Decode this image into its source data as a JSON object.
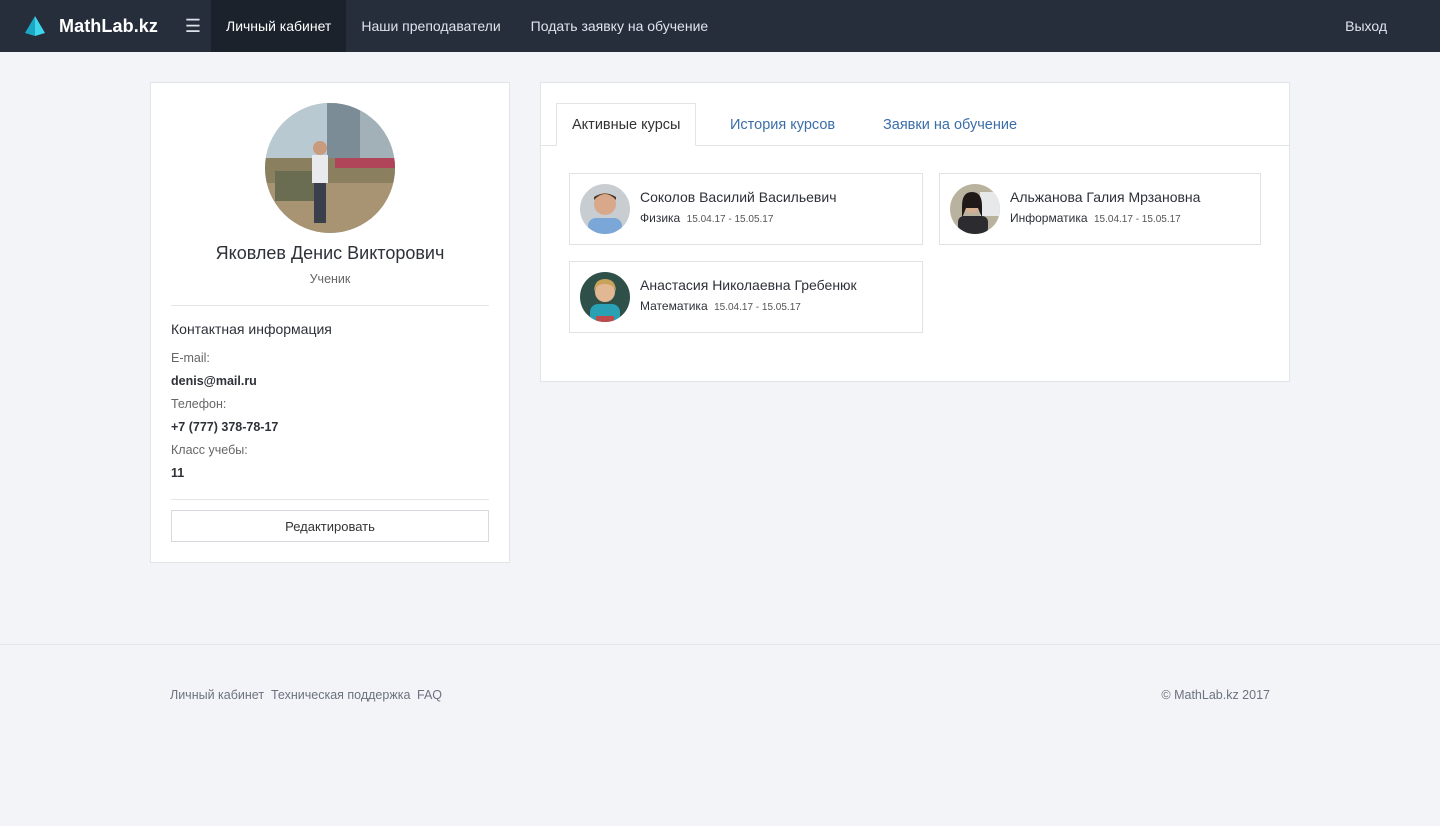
{
  "navbar": {
    "brand": "MathLab.kz",
    "links": [
      {
        "label": "Личный кабинет"
      },
      {
        "label": "Наши преподаватели"
      },
      {
        "label": "Подать заявку на обучение"
      }
    ],
    "logout": "Выход",
    "colors": {
      "background": "#262e3b",
      "active": "#1b222c",
      "logo": "#2fc4dd"
    }
  },
  "profile": {
    "name": "Яковлев Денис Викторович",
    "role": "Ученик",
    "contact_title": "Контактная информация",
    "fields": [
      {
        "label": "E-mail:",
        "value": "denis@mail.ru"
      },
      {
        "label": "Телефон:",
        "value": "+7 (777) 378-78-17"
      },
      {
        "label": "Класс учебы:",
        "value": "11"
      }
    ],
    "edit_button": "Редактировать"
  },
  "courses": {
    "tabs": [
      {
        "label": "Активные курсы",
        "active": true
      },
      {
        "label": "История курсов",
        "active": false
      },
      {
        "label": "Заявки на обучение",
        "active": false
      }
    ],
    "cards": [
      {
        "teacher": "Соколов Василий Васильевич",
        "subject": "Физика",
        "dates": "15.04.17 - 15.05.17"
      },
      {
        "teacher": "Альжанова Галия Мрзановна",
        "subject": "Информатика",
        "dates": "15.04.17 - 15.05.17"
      },
      {
        "teacher": "Анастасия Николаевна Гребенюк",
        "subject": "Математика",
        "dates": "15.04.17 - 15.05.17"
      }
    ]
  },
  "footer": {
    "links": [
      {
        "label": "Личный кабинет"
      },
      {
        "label": "Техническая поддержка"
      },
      {
        "label": "FAQ"
      }
    ],
    "copyright": "© MathLab.kz 2017"
  }
}
